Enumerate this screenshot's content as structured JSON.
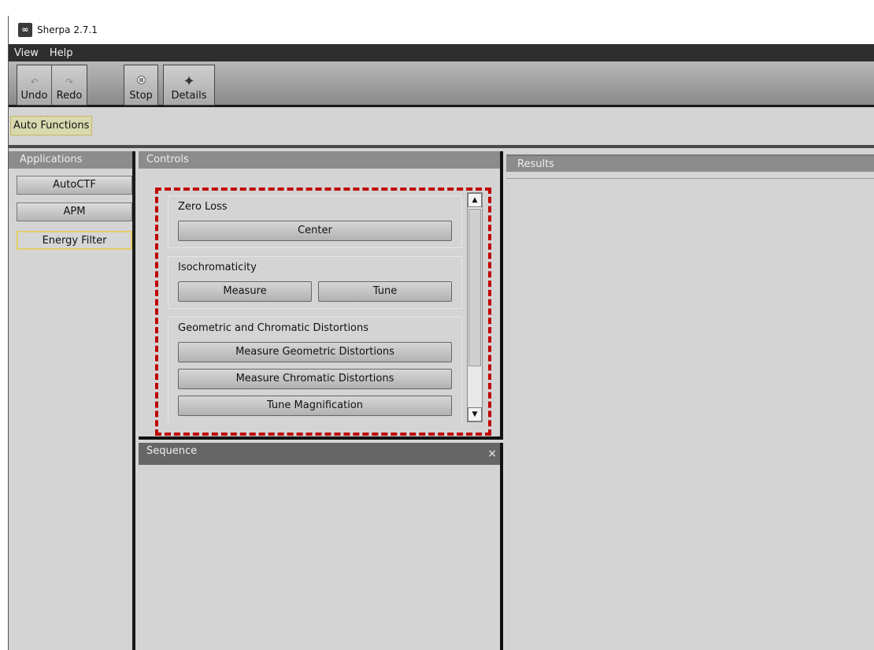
{
  "window": {
    "title": "Sherpa 2.7.1",
    "icon": "sherpa-app-icon"
  },
  "menu": [
    "View",
    "Help"
  ],
  "toolbar": {
    "undo": {
      "label": "Undo",
      "icon": "undo-icon"
    },
    "redo": {
      "label": "Redo",
      "icon": "redo-icon"
    },
    "stop": {
      "label": "Stop",
      "icon": "stop-icon"
    },
    "details": {
      "label": "Details",
      "icon": "plus-icon"
    }
  },
  "auto_functions": {
    "label": "Auto Functions"
  },
  "applications": {
    "header": "Applications",
    "items": [
      "AutoCTF",
      "APM",
      "Energy Filter"
    ],
    "selected": "Energy Filter"
  },
  "controls": {
    "header": "Controls",
    "groups": {
      "zero_loss": {
        "title": "Zero Loss",
        "buttons": [
          "Center"
        ]
      },
      "isochromaticity": {
        "title": "Isochromaticity",
        "buttons": [
          "Measure",
          "Tune"
        ]
      },
      "distortions": {
        "title": "Geometric and Chromatic Distortions",
        "buttons": [
          "Measure Geometric Distortions",
          "Measure Chromatic Distortions",
          "Tune Magnification"
        ]
      }
    }
  },
  "sequence": {
    "header": "Sequence",
    "close": "×"
  },
  "results": {
    "header": "Results"
  },
  "colors": {
    "highlight_dash": "#c00000",
    "selected_border": "#e3cc6a"
  }
}
